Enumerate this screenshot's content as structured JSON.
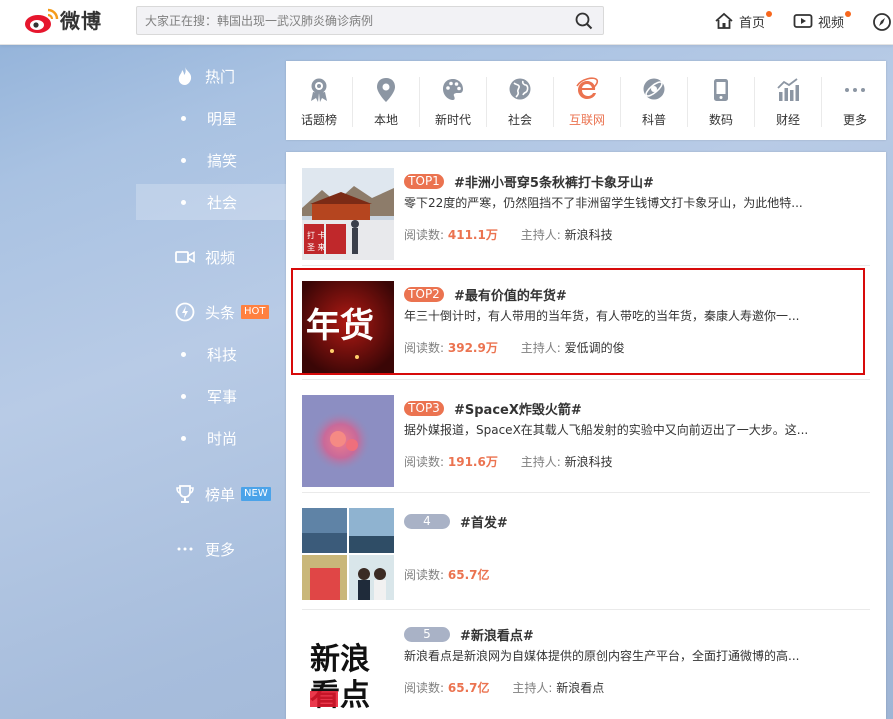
{
  "header": {
    "logo_text": "微博",
    "search_placeholder": "大家正在搜：韩国出现一武汉肺炎确诊病例",
    "nav": [
      {
        "label": "首页"
      },
      {
        "label": "视频"
      }
    ]
  },
  "sidebar": {
    "items": [
      {
        "label": "热门",
        "icon": "fire-icon"
      },
      {
        "label": "明星"
      },
      {
        "label": "搞笑"
      },
      {
        "label": "社会"
      },
      {
        "label": "视频",
        "icon": "video-camera-icon"
      },
      {
        "label": "头条",
        "icon": "lightning-icon",
        "badge": "HOT"
      },
      {
        "label": "科技"
      },
      {
        "label": "军事"
      },
      {
        "label": "时尚"
      },
      {
        "label": "榜单",
        "icon": "trophy-icon",
        "badge": "NEW"
      },
      {
        "label": "更多",
        "icon": "more-dots-icon"
      }
    ],
    "active_index": 3,
    "colors": {
      "hot_badge": "#ff8140",
      "new_badge": "#4ba3e9"
    }
  },
  "categories": {
    "items": [
      {
        "label": "话题榜",
        "icon": "ribbon-badge-icon"
      },
      {
        "label": "本地",
        "icon": "location-pin-icon"
      },
      {
        "label": "新时代",
        "icon": "palette-icon"
      },
      {
        "label": "社会",
        "icon": "globe-icon"
      },
      {
        "label": "互联网",
        "icon": "ie-browser-icon"
      },
      {
        "label": "科普",
        "icon": "satellite-icon"
      },
      {
        "label": "数码",
        "icon": "phone-icon"
      },
      {
        "label": "财经",
        "icon": "bar-chart-icon"
      },
      {
        "label": "更多",
        "icon": "more-dots-icon"
      }
    ],
    "selected_index": 4,
    "accent_color": "#eb7350"
  },
  "feed": {
    "read_label": "阅读数:",
    "host_label": "主持人:",
    "items": [
      {
        "rank": "TOP1",
        "title": "#非洲小哥穿5条秋裤打卡象牙山#",
        "desc": "零下22度的严寒，仍然阻挡不了非洲留学生钱博文打卡象牙山，为此他特...",
        "reads": "411.1万",
        "host": "新浪科技"
      },
      {
        "rank": "TOP2",
        "title": "#最有价值的年货#",
        "desc": "年三十倒计时，有人带用的当年货，有人带吃的当年货，秦康人寿邀你一...",
        "reads": "392.9万",
        "host": "爱低调的俊"
      },
      {
        "rank": "TOP3",
        "title": "#SpaceX炸毁火箭#",
        "desc": "据外媒报道，SpaceX在其载人飞船发射的实验中又向前迈出了一大步。这...",
        "reads": "191.6万",
        "host": "新浪科技"
      },
      {
        "rank": "4",
        "title": "#首发#",
        "desc": "",
        "reads": "65.7亿",
        "host": ""
      },
      {
        "rank": "5",
        "title": "#新浪看点#",
        "desc": "新浪看点是新浪网为自媒体提供的原创内容生产平台，全面打通微博的高...",
        "reads": "65.7亿",
        "host": "新浪看点"
      }
    ],
    "thumb_text": {
      "nianhuo": "年货",
      "kandian_1": "新浪",
      "kandian_2": "看点",
      "fence_1": "打  卡",
      "fence_2": "圣  来"
    }
  }
}
